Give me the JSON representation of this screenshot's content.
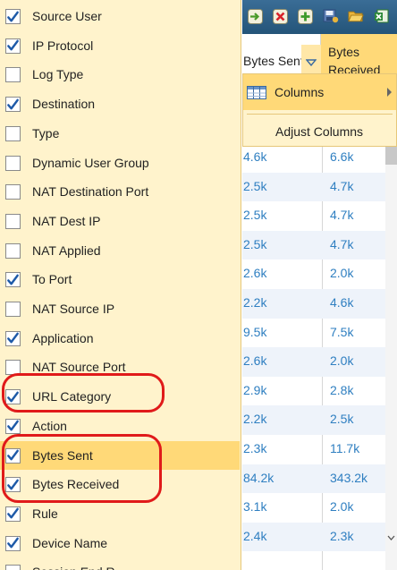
{
  "column_menu": {
    "items": [
      {
        "label": "Source User",
        "checked": true
      },
      {
        "label": "IP Protocol",
        "checked": true
      },
      {
        "label": "Log Type",
        "checked": false
      },
      {
        "label": "Destination",
        "checked": true
      },
      {
        "label": "Type",
        "checked": false
      },
      {
        "label": "Dynamic User Group",
        "checked": false
      },
      {
        "label": "NAT Destination Port",
        "checked": false
      },
      {
        "label": "NAT Dest IP",
        "checked": false
      },
      {
        "label": "NAT Applied",
        "checked": false
      },
      {
        "label": "To Port",
        "checked": true
      },
      {
        "label": "NAT Source IP",
        "checked": false
      },
      {
        "label": "Application",
        "checked": true
      },
      {
        "label": "NAT Source Port",
        "checked": false
      },
      {
        "label": "URL Category",
        "checked": true
      },
      {
        "label": "Action",
        "checked": true
      },
      {
        "label": "Bytes Sent",
        "checked": true,
        "highlighted": true
      },
      {
        "label": "Bytes Received",
        "checked": true
      },
      {
        "label": "Rule",
        "checked": true
      },
      {
        "label": "Device Name",
        "checked": true
      },
      {
        "label": "Session End R",
        "checked": false
      }
    ]
  },
  "toolbar": {
    "icons": [
      "go-arrow-icon",
      "delete-icon",
      "add-icon",
      "save-icon",
      "open-folder-icon",
      "excel-export-icon"
    ]
  },
  "grid": {
    "headers": {
      "bytes_sent": "Bytes Sent",
      "bytes_received": "Bytes Received"
    },
    "rows": [
      {
        "sent": "4.6k",
        "received": "6.6k"
      },
      {
        "sent": "2.5k",
        "received": "4.7k"
      },
      {
        "sent": "2.5k",
        "received": "4.7k"
      },
      {
        "sent": "2.5k",
        "received": "4.7k"
      },
      {
        "sent": "2.6k",
        "received": "2.0k"
      },
      {
        "sent": "2.2k",
        "received": "4.6k"
      },
      {
        "sent": "9.5k",
        "received": "7.5k"
      },
      {
        "sent": "2.6k",
        "received": "2.0k"
      },
      {
        "sent": "2.9k",
        "received": "2.8k"
      },
      {
        "sent": "2.2k",
        "received": "2.5k"
      },
      {
        "sent": "2.3k",
        "received": "11.7k"
      },
      {
        "sent": "84.2k",
        "received": "343.2k"
      },
      {
        "sent": "3.1k",
        "received": "2.0k"
      },
      {
        "sent": "2.4k",
        "received": "2.3k"
      }
    ]
  },
  "header_menu": {
    "columns_label": "Columns",
    "adjust_label": "Adjust Columns"
  },
  "colors": {
    "menu_bg": "#fff3cc",
    "menu_highlight": "#ffd978",
    "checkbox_check": "#1e5aa8",
    "cell_text": "#2f7fc1",
    "toolbar_bg": "#2f618a",
    "annotation": "#e01a1a"
  }
}
